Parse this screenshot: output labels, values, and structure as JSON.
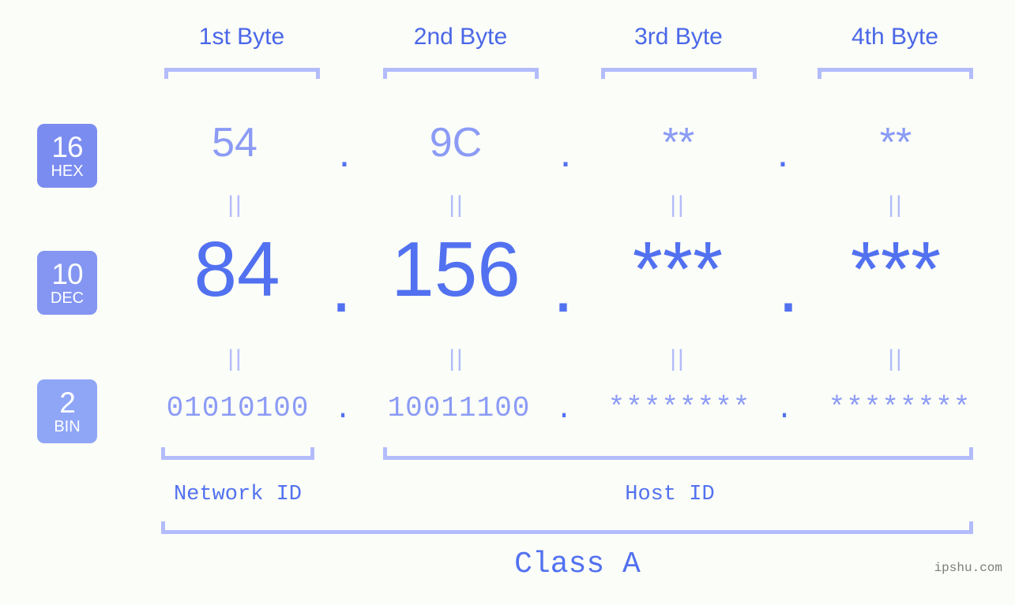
{
  "page": {
    "background_color": "#fbfdf8",
    "watermark": "ipshu.com"
  },
  "colors": {
    "header_blue": "#4a67e8",
    "strong_blue": "#5271f0",
    "light_blue": "#8b9bf5",
    "bracket_blue": "#b3bcfb",
    "badge_hex": "#7b8cf0",
    "badge_dec": "#8496f2",
    "badge_bin": "#8fa6f7",
    "watermark_grey": "#7d7d7d"
  },
  "byte_headers": [
    {
      "label": "1st Byte"
    },
    {
      "label": "2nd Byte"
    },
    {
      "label": "3rd Byte"
    },
    {
      "label": "4th Byte"
    }
  ],
  "bases": [
    {
      "number": "16",
      "name": "HEX"
    },
    {
      "number": "10",
      "name": "DEC"
    },
    {
      "number": "2",
      "name": "BIN"
    }
  ],
  "rows": {
    "hex": {
      "base_number": "16",
      "base_name": "HEX",
      "values": [
        "54",
        "9C",
        "**",
        "**"
      ],
      "separator": "."
    },
    "dec": {
      "base_number": "10",
      "base_name": "DEC",
      "values": [
        "84",
        "156",
        "***",
        "***"
      ],
      "separator": "."
    },
    "bin": {
      "base_number": "2",
      "base_name": "BIN",
      "values": [
        "01010100",
        "10011100",
        "********",
        "********"
      ],
      "separator": "."
    }
  },
  "equivalence_symbol": "||",
  "segments": {
    "network_id": "Network ID",
    "host_id": "Host ID",
    "class": "Class A"
  }
}
